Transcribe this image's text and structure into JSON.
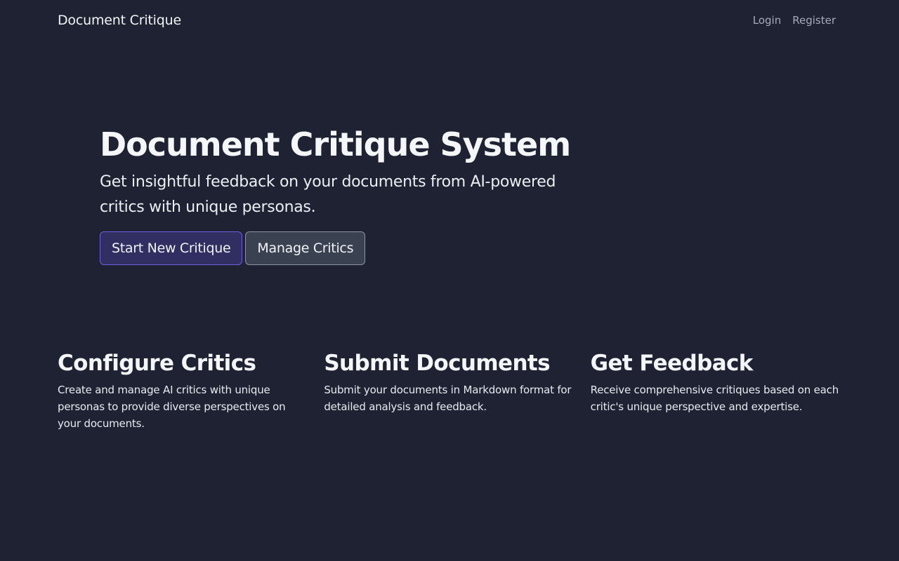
{
  "navbar": {
    "brand": "Document Critique",
    "links": [
      {
        "label": "Login"
      },
      {
        "label": "Register"
      }
    ]
  },
  "hero": {
    "title": "Document Critique System",
    "subtitle": "Get insightful feedback on your documents from AI-powered critics with unique personas.",
    "primary_button": "Start New Critique",
    "secondary_button": "Manage Critics"
  },
  "features": [
    {
      "title": "Configure Critics",
      "text": "Create and manage AI critics with unique personas to provide diverse perspectives on your documents."
    },
    {
      "title": "Submit Documents",
      "text": "Submit your documents in Markdown format for detailed analysis and feedback."
    },
    {
      "title": "Get Feedback",
      "text": "Receive comprehensive critiques based on each critic's unique perspective and expertise."
    }
  ],
  "colors": {
    "background": "#1e2232",
    "primary_button_bg": "#312e62",
    "primary_button_border": "#6a5fe0",
    "secondary_button_bg": "#3a4150",
    "nav_link": "#a6abb8"
  }
}
